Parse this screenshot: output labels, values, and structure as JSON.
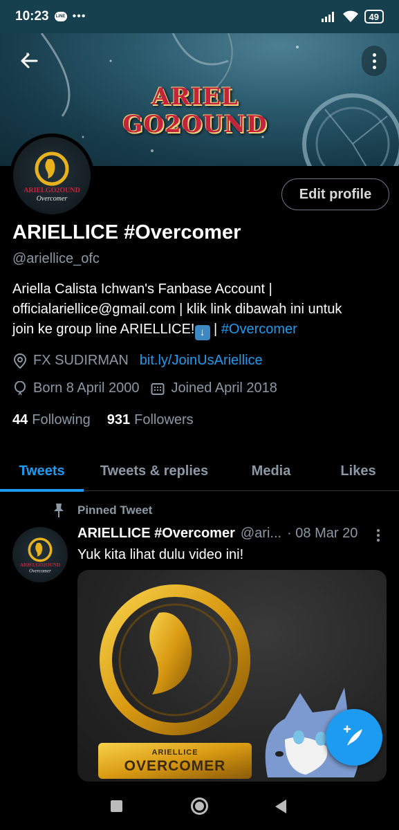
{
  "status_bar": {
    "time": "10:23",
    "app_badge": "LINE",
    "overflow": "•••",
    "battery": "49"
  },
  "banner": {
    "title": "ARIEL GO2OUND"
  },
  "profile": {
    "edit_label": "Edit profile",
    "name": "ARIELLICE #Overcomer",
    "handle": "@ariellice_ofc",
    "bio_line1": "Ariella Calista Ichwan's Fanbase Account |",
    "bio_line2": "officialariellice@gmail.com | klik link dibawah ini untuk",
    "bio_line3_text": "join ke group line ARIELLICE!",
    "bio_line3_sep": " | ",
    "bio_hashtag": "#Overcomer",
    "location": "FX SUDIRMAN",
    "link": "bit.ly/JoinUsAriellice",
    "born": "Born 8 April 2000",
    "joined": "Joined April 2018",
    "following_count": "44",
    "following_label": "Following",
    "followers_count": "931",
    "followers_label": "Followers",
    "avatar_text_top": "ARIELGO2OUND",
    "avatar_text_bottom": "Overcomer"
  },
  "tabs": [
    {
      "label": "Tweets",
      "active": true
    },
    {
      "label": "Tweets & replies",
      "active": false
    },
    {
      "label": "Media",
      "active": false
    },
    {
      "label": "Likes",
      "active": false
    }
  ],
  "pinned_tweet": {
    "pinned_label": "Pinned Tweet",
    "author_name": "ARIELLICE #Overcomer",
    "author_handle": "@ari...",
    "date": "· 08 Mar 20",
    "text": "Yuk kita lihat dulu video ini!",
    "media_small_label": "ARIELLICE",
    "media_big_label": "OVERCOMER"
  },
  "colors": {
    "accent": "#1d9bf0",
    "muted": "#8b98a5",
    "status_bar": "#16404d",
    "gold": "#e8b21e"
  },
  "icons": [
    "back-arrow-icon",
    "more-vertical-icon",
    "location-icon",
    "balloon-icon",
    "calendar-icon",
    "pin-icon",
    "compose-tweet-icon"
  ]
}
